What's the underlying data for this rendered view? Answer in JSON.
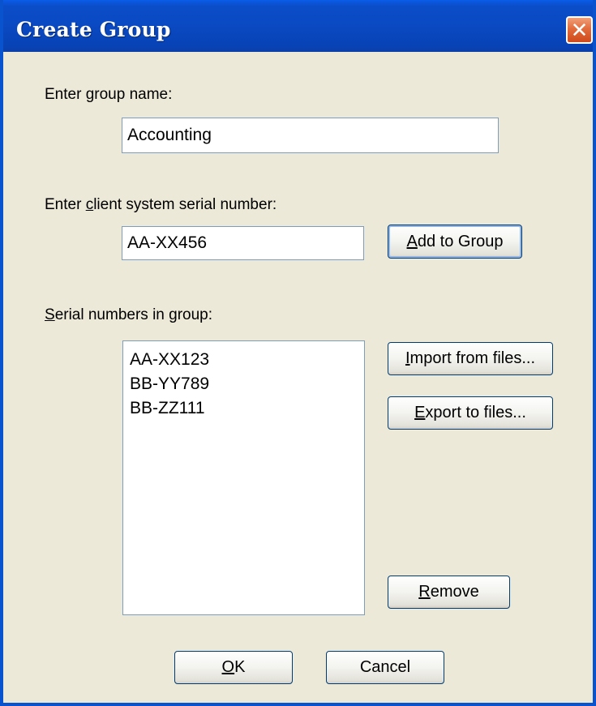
{
  "window": {
    "title": "Create Group",
    "close_symbol": "✕"
  },
  "group_name": {
    "label_prefix": "Enter ",
    "label_mnemonic": "g",
    "label_suffix": "roup name:",
    "value": "Accounting"
  },
  "serial_entry": {
    "label_prefix": "Enter ",
    "label_mnemonic": "c",
    "label_suffix": "lient system serial number:",
    "value": "AA-XX456",
    "add_button": {
      "mnemonic": "A",
      "rest": "dd to Group"
    }
  },
  "serial_list": {
    "label_mnemonic": "S",
    "label_rest": "erial numbers in group:",
    "items": [
      "AA-XX123",
      "BB-YY789",
      "BB-ZZ111"
    ]
  },
  "buttons": {
    "import": {
      "mnemonic": "I",
      "rest": "mport from files..."
    },
    "export": {
      "mnemonic": "E",
      "rest": "xport to files..."
    },
    "remove": {
      "mnemonic": "R",
      "rest": "emove"
    },
    "ok": {
      "mnemonic": "O",
      "rest": "K"
    },
    "cancel": {
      "label": "Cancel"
    }
  }
}
